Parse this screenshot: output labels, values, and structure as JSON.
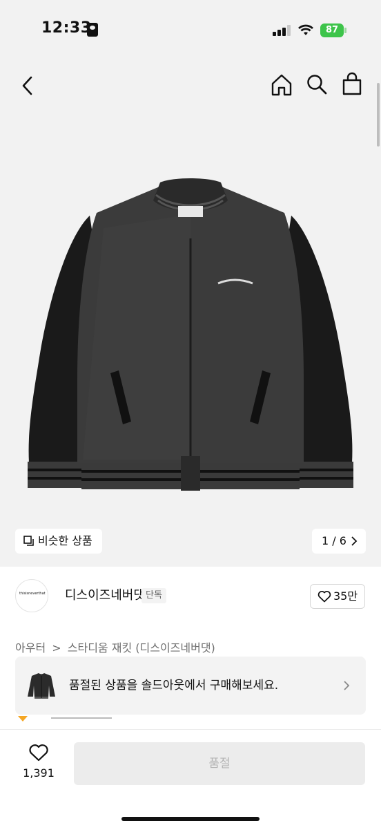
{
  "status_bar": {
    "time": "12:33",
    "battery": "87",
    "colors": {
      "battery": "#3dc44a"
    }
  },
  "header": {
    "icons": [
      "chevron-left-icon",
      "home-icon",
      "search-icon",
      "shopping-bag-icon"
    ]
  },
  "gallery": {
    "similar_label": "비슷한 상품",
    "pager": "1 / 6"
  },
  "brand": {
    "logo_text": "thisisneverthat",
    "name": "디스이즈네버댓",
    "badge": "단독",
    "likes": "35만"
  },
  "breadcrumb": {
    "category": "아우터",
    "separator": ">",
    "product": "스타디움 재킷 (디스이즈네버댓)"
  },
  "soldout_banner": {
    "text": "품절된 상품을 솔드아웃에서 구매해보세요."
  },
  "bottom_bar": {
    "wish_count": "1,391",
    "buy_label": "품절"
  }
}
